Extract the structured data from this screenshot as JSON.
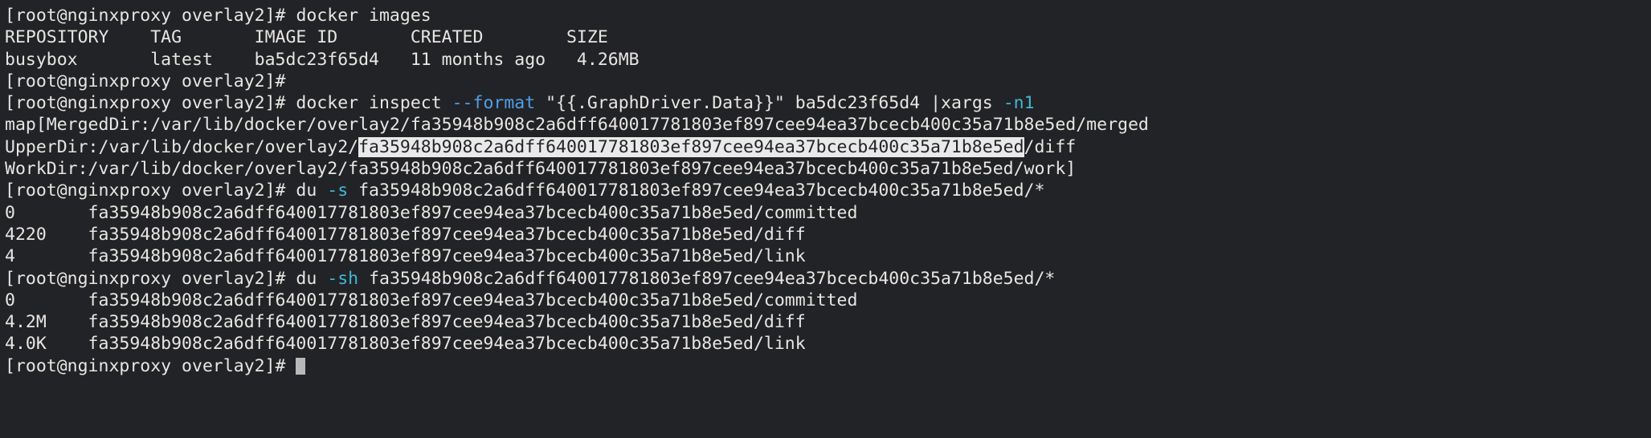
{
  "terminal": {
    "window_title": "root@nginxproxy:/var/lib/docker/overlay2",
    "colors": {
      "background": "#222326",
      "foreground": "#e8e6e3",
      "cyan": "#3fb9d6",
      "blue": "#4ea0e8",
      "selection_background": "#e9e9e9",
      "selection_foreground": "#222326",
      "cursor": "#b9b9b9"
    },
    "prompt": "[root@nginxproxy overlay2]# ",
    "hash": "fa35948b908c2a6dff640017781803ef897cee94ea37bcecb400c35a71b8e5ed",
    "lines": [
      {
        "id": "line-1-cmd-docker-images",
        "segments": [
          {
            "text": "[root@nginxproxy overlay2]# ",
            "color": "default"
          },
          {
            "text": "docker images",
            "color": "default"
          }
        ]
      },
      {
        "id": "line-2-images-header",
        "segments": [
          {
            "text": "REPOSITORY    TAG       IMAGE ID       CREATED        SIZE",
            "color": "default"
          }
        ]
      },
      {
        "id": "line-3-images-row-busybox",
        "segments": [
          {
            "text": "busybox       latest    ba5dc23f65d4   11 months ago   4.26MB",
            "color": "default"
          }
        ]
      },
      {
        "id": "line-4-empty-prompt",
        "segments": [
          {
            "text": "[root@nginxproxy overlay2]# ",
            "color": "default"
          }
        ]
      },
      {
        "id": "line-5-cmd-docker-inspect",
        "segments": [
          {
            "text": "[root@nginxproxy overlay2]# docker inspect ",
            "color": "default"
          },
          {
            "text": "--format",
            "color": "blue"
          },
          {
            "text": " \"{{",
            "color": "default"
          },
          {
            "text": ".GraphDriver.Data",
            "color": "default"
          },
          {
            "text": "}}\" ba5dc23f65d4 |xargs ",
            "color": "default"
          },
          {
            "text": "-n1",
            "color": "cyan"
          }
        ]
      },
      {
        "id": "line-6-output-mergeddir",
        "segments": [
          {
            "text": "map[MergedDir:/var/lib/docker/overlay2/fa35948b908c2a6dff640017781803ef897cee94ea37bcecb400c35a71b8e5ed/merged",
            "color": "default"
          }
        ]
      },
      {
        "id": "line-7-output-upperdir",
        "segments": [
          {
            "text": "UpperDir:/var/lib/docker/overlay2/",
            "color": "default"
          },
          {
            "text": "fa35948b908c2a6dff640017781803ef897cee94ea37bcecb400c35a71b8e5ed",
            "color": "default",
            "selected": true
          },
          {
            "text": "/diff",
            "color": "default"
          }
        ]
      },
      {
        "id": "line-8-output-workdir",
        "segments": [
          {
            "text": "WorkDir:/var/lib/docker/overlay2/fa35948b908c2a6dff640017781803ef897cee94ea37bcecb400c35a71b8e5ed/work]",
            "color": "default"
          }
        ]
      },
      {
        "id": "line-9-cmd-du-s",
        "segments": [
          {
            "text": "[root@nginxproxy overlay2]# du ",
            "color": "default"
          },
          {
            "text": "-s",
            "color": "cyan"
          },
          {
            "text": " fa35948b908c2a6dff640017781803ef897cee94ea37bcecb400c35a71b8e5ed/*",
            "color": "default"
          }
        ]
      },
      {
        "id": "line-10-du-s-committed",
        "segments": [
          {
            "text": "0       fa35948b908c2a6dff640017781803ef897cee94ea37bcecb400c35a71b8e5ed/committed",
            "color": "default"
          }
        ]
      },
      {
        "id": "line-11-du-s-diff",
        "segments": [
          {
            "text": "4220    fa35948b908c2a6dff640017781803ef897cee94ea37bcecb400c35a71b8e5ed/diff",
            "color": "default"
          }
        ]
      },
      {
        "id": "line-12-du-s-link",
        "segments": [
          {
            "text": "4       fa35948b908c2a6dff640017781803ef897cee94ea37bcecb400c35a71b8e5ed/link",
            "color": "default"
          }
        ]
      },
      {
        "id": "line-13-cmd-du-sh",
        "segments": [
          {
            "text": "[root@nginxproxy overlay2]# du ",
            "color": "default"
          },
          {
            "text": "-sh",
            "color": "cyan"
          },
          {
            "text": " fa35948b908c2a6dff640017781803ef897cee94ea37bcecb400c35a71b8e5ed/*",
            "color": "default"
          }
        ]
      },
      {
        "id": "line-14-du-sh-committed",
        "segments": [
          {
            "text": "0       fa35948b908c2a6dff640017781803ef897cee94ea37bcecb400c35a71b8e5ed/committed",
            "color": "default"
          }
        ]
      },
      {
        "id": "line-15-du-sh-diff",
        "segments": [
          {
            "text": "4.2M    fa35948b908c2a6dff640017781803ef897cee94ea37bcecb400c35a71b8e5ed/diff",
            "color": "default"
          }
        ]
      },
      {
        "id": "line-16-du-sh-link",
        "segments": [
          {
            "text": "4.0K    fa35948b908c2a6dff640017781803ef897cee94ea37bcecb400c35a71b8e5ed/link",
            "color": "default"
          }
        ]
      },
      {
        "id": "line-17-final-prompt",
        "segments": [
          {
            "text": "[root@nginxproxy overlay2]# ",
            "color": "default"
          }
        ],
        "cursor": true
      }
    ]
  }
}
